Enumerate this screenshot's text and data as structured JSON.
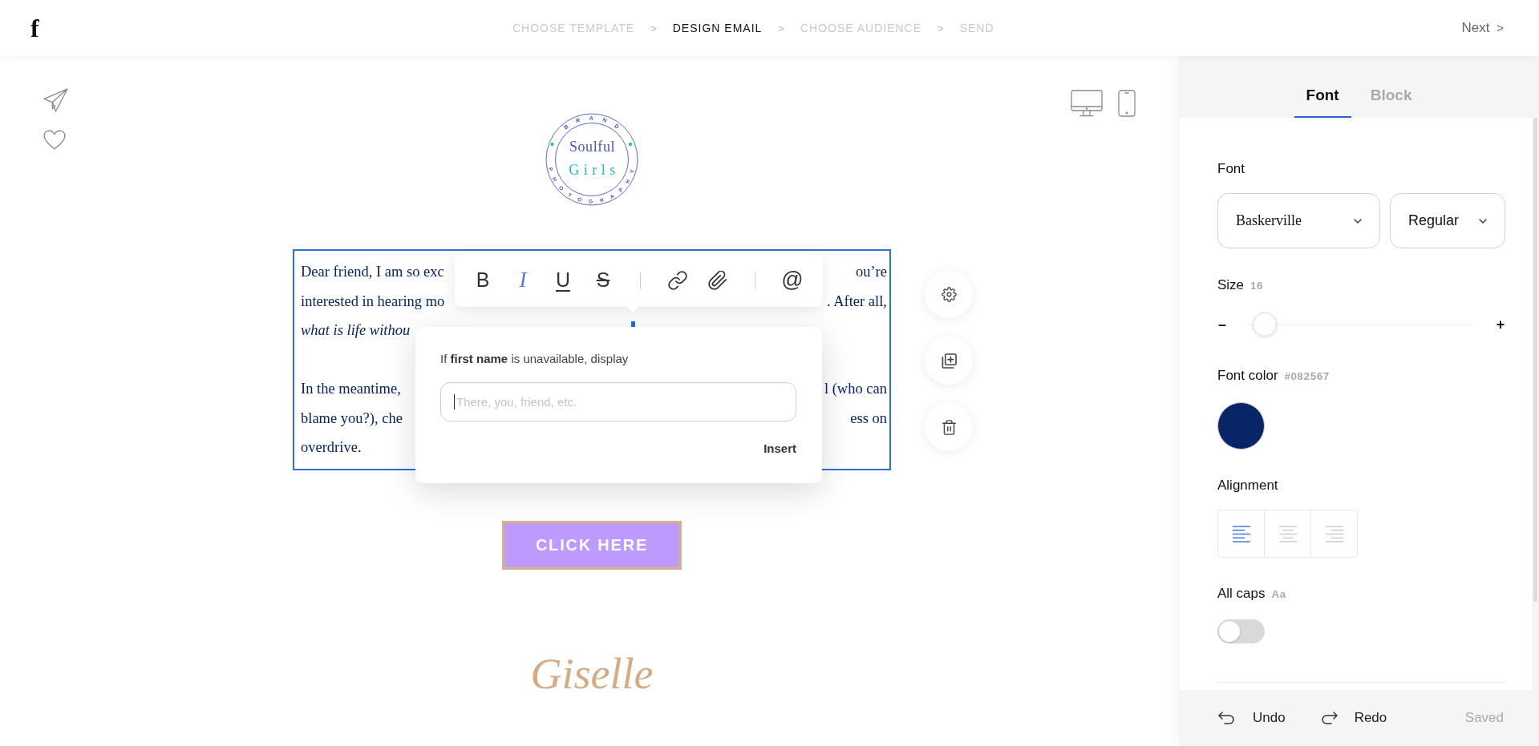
{
  "top_bar": {
    "logo": "f",
    "steps": [
      {
        "label": "CHOOSE TEMPLATE",
        "selected": false
      },
      {
        "label": "DESIGN EMAIL",
        "selected": true
      },
      {
        "label": "CHOOSE AUDIENCE",
        "selected": false
      },
      {
        "label": "SEND",
        "selected": false
      }
    ],
    "separators": [
      ">",
      ">",
      ">"
    ],
    "next": {
      "label": "Next",
      "arrow": ">"
    }
  },
  "email": {
    "logo": {
      "arc_top": "BRAND",
      "arc_bottom": "PHOTOGRAPHY",
      "line_1": "Soulful",
      "line_2": "Girls"
    },
    "text_block": {
      "paragraphs": [
        {
          "lines": [
            {
              "left": "Dear friend, I am so exc",
              "right": "ou’re",
              "italic": false
            },
            {
              "left": "interested in hearing mo",
              "right": ". After all,",
              "italic": false
            },
            {
              "left": "what is life withou",
              "italic": true
            }
          ]
        },
        {
          "lines": [
            {
              "left": "In the meantime,",
              "right": "l (who can",
              "italic": false
            },
            {
              "left": "blame you?), che",
              "right": "ess on",
              "italic": false
            },
            {
              "left": "overdrive.",
              "italic": false
            }
          ]
        }
      ]
    },
    "toolbar": {
      "groups": [
        {
          "items": [
            {
              "kind": "bold",
              "label": "B",
              "selected": false
            },
            {
              "kind": "italic",
              "label": "I",
              "selected": true
            },
            {
              "kind": "underline",
              "label": "U",
              "selected": false
            },
            {
              "kind": "strike",
              "label": "S",
              "selected": false
            }
          ]
        },
        {
          "items": [
            {
              "kind": "link",
              "selected": false
            },
            {
              "kind": "attach",
              "selected": false
            }
          ]
        },
        {
          "items": [
            {
              "kind": "mention",
              "label": "@",
              "selected": false
            }
          ]
        }
      ]
    },
    "fallback_popup": {
      "prompt": "If **first name** is unavailable, display",
      "placeholder": "There, you, friend, etc.",
      "action": "Insert"
    },
    "cta_button": "CLICK HERE",
    "signature": "Giselle"
  },
  "panel": {
    "tabs": [
      {
        "label": "Font",
        "selected": true
      },
      {
        "label": "Block",
        "selected": false
      }
    ],
    "font": {
      "label": "Font",
      "family": "Baskerville",
      "weight": "Regular"
    },
    "size": {
      "label": "Size",
      "value": "16",
      "decrease": "–",
      "increase": "+",
      "level": 0.02
    },
    "font_color": {
      "label": "Font color",
      "value": "#082567",
      "color": "#082567"
    },
    "alignment": {
      "label": "Alignment",
      "options": [
        {
          "kind": "left",
          "selected": true
        },
        {
          "kind": "center",
          "selected": false
        },
        {
          "kind": "right",
          "selected": false
        }
      ]
    },
    "all_caps": {
      "label": "All caps",
      "hint": "Aa",
      "on": false
    },
    "footer": {
      "undo": "Undo",
      "redo": "Redo",
      "status": "Saved"
    }
  }
}
